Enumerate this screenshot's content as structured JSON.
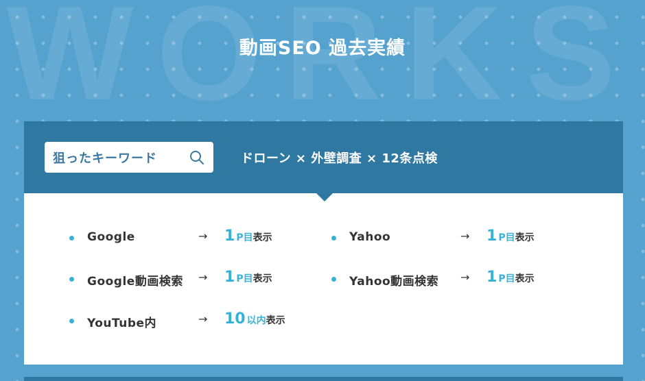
{
  "watermark": "WORKS",
  "heading": "動画SEO 過去実績",
  "keyword": {
    "label": "狙ったキーワード",
    "icon": "search-icon",
    "text": "ドローン × 外壁調査 × 12条点検"
  },
  "results": [
    {
      "engine": "Google",
      "arrow": "→",
      "num": "1",
      "unit": "P目",
      "suffix": "表示"
    },
    {
      "engine": "Yahoo",
      "arrow": "→",
      "num": "1",
      "unit": "P目",
      "suffix": "表示"
    },
    {
      "engine": "Google動画検索",
      "arrow": "→",
      "num": "1",
      "unit": "P目",
      "suffix": "表示"
    },
    {
      "engine": "Yahoo動画検索",
      "arrow": "→",
      "num": "1",
      "unit": "P目",
      "suffix": "表示"
    },
    {
      "engine": "YouTube内",
      "arrow": "→",
      "num": "10",
      "unit": "以内",
      "suffix": "表示"
    }
  ],
  "colors": {
    "background": "#55a2cf",
    "header": "#2f78a2",
    "accent": "#37b2d7",
    "text": "#333333"
  }
}
